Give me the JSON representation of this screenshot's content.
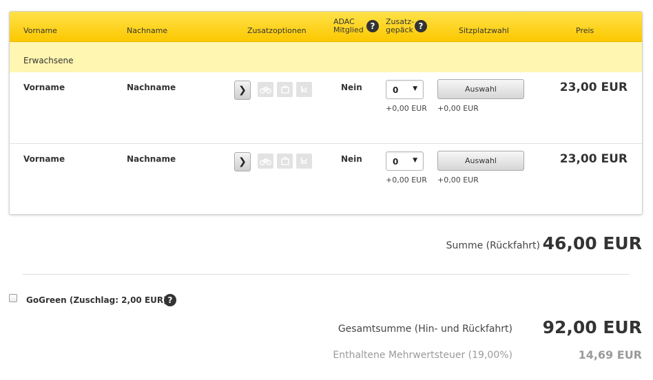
{
  "header": {
    "col_first_name": "Vorname",
    "col_last_name": "Nachname",
    "col_options": "Zusatzoptionen",
    "col_adac_line1": "ADAC",
    "col_adac_line2": "Mitglied",
    "col_luggage_line1": "Zusatz-",
    "col_luggage_line2": "gepäck",
    "col_seat": "Sitzplatzwahl",
    "col_price": "Preis",
    "help_symbol": "?"
  },
  "section": {
    "label": "Erwachsene"
  },
  "passengers": [
    {
      "first_name": "Vorname",
      "last_name": "Nachname",
      "adac": "Nein",
      "luggage_value": "0",
      "luggage_price": "+0,00 EUR",
      "seat_button": "Auswahl",
      "seat_price": "+0,00 EUR",
      "price": "23,00 EUR"
    },
    {
      "first_name": "Vorname",
      "last_name": "Nachname",
      "adac": "Nein",
      "luggage_value": "0",
      "luggage_price": "+0,00 EUR",
      "seat_button": "Auswahl",
      "seat_price": "+0,00 EUR",
      "price": "23,00 EUR"
    }
  ],
  "icons": {
    "expand": "chevron-right-icon",
    "bicycle": "bicycle-icon",
    "luggage": "luggage-icon",
    "seat": "seat-icon",
    "help": "help-icon"
  },
  "summary": {
    "sum_label": "Summe (Rückfahrt)",
    "sum_value": "46,00 EUR",
    "gogreen_label": "GoGreen (Zuschlag: 2,00 EUR)",
    "total_label": "Gesamtsumme (Hin- und Rückfahrt)",
    "total_value": "92,00 EUR",
    "vat_label": "Enthaltene Mehrwertsteuer (19,00%)",
    "vat_value": "14,69 EUR"
  },
  "colors": {
    "header_yellow": "#fcc800",
    "section_yellow": "#fff6b1",
    "muted_text": "#9a9a9a"
  }
}
